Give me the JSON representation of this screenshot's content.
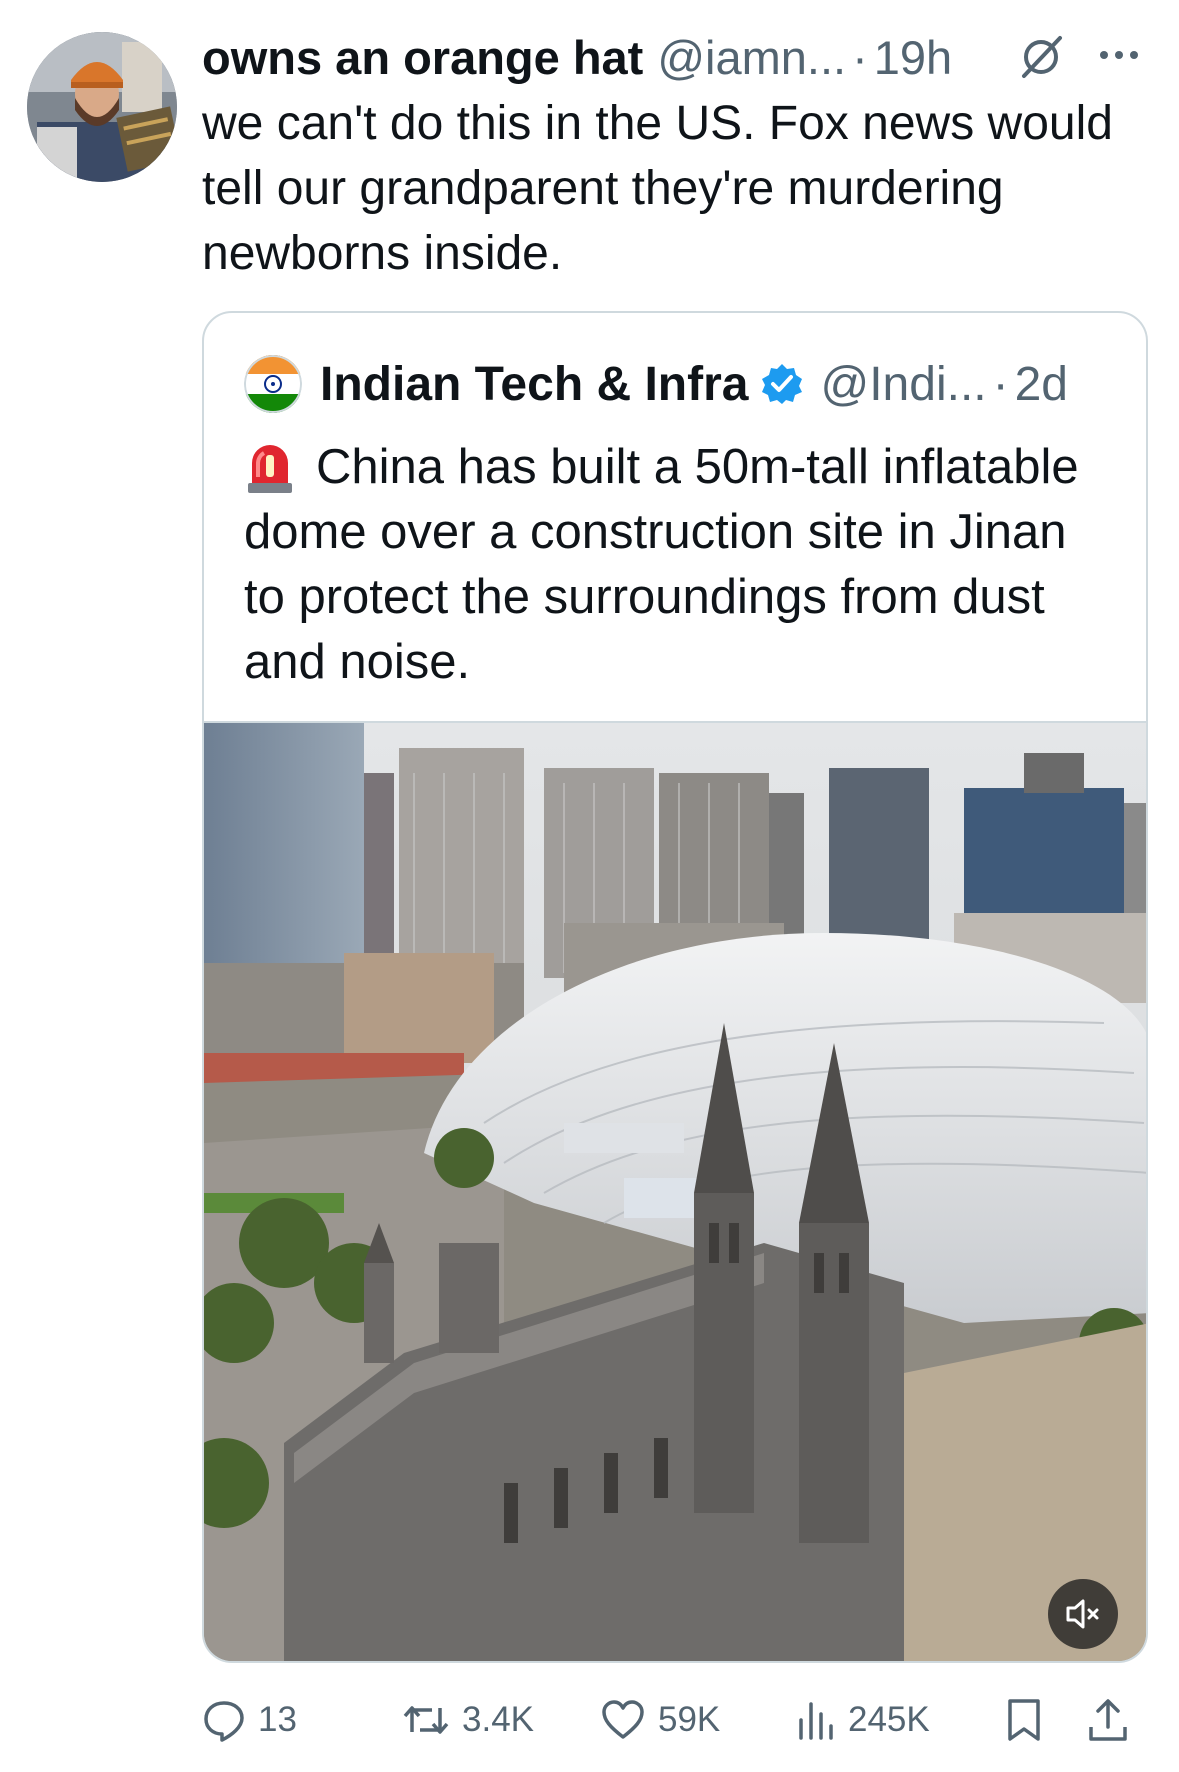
{
  "tweet": {
    "author_name": "owns an orange hat",
    "author_handle": "@iamn...",
    "separator": "·",
    "time": "19h",
    "text": "we can't do this in the US. Fox news would tell our grandparent they're murdering newborns inside.",
    "grok_icon": "grok-icon",
    "more_icon": "more-icon"
  },
  "quote": {
    "author_name": "Indian Tech & Infra",
    "verified_icon": "verified-badge-icon",
    "author_handle": "@Indi...",
    "separator": "·",
    "time": "2d",
    "emoji": "siren-emoji",
    "text": "China has built a 50m-tall inflatable dome over a construction site in Jinan to protect the surroundings from dust and noise.",
    "media": {
      "kind": "video",
      "mute_icon": "speaker-muted-icon"
    }
  },
  "actions": {
    "replies": "13",
    "reposts": "3.4K",
    "likes": "59K",
    "views": "245K",
    "bookmark_icon": "bookmark-icon",
    "share_icon": "share-icon"
  },
  "colors": {
    "text": "#0f1419",
    "secondary": "#536471",
    "border": "#cfd9de",
    "verified": "#1d9bf0"
  }
}
